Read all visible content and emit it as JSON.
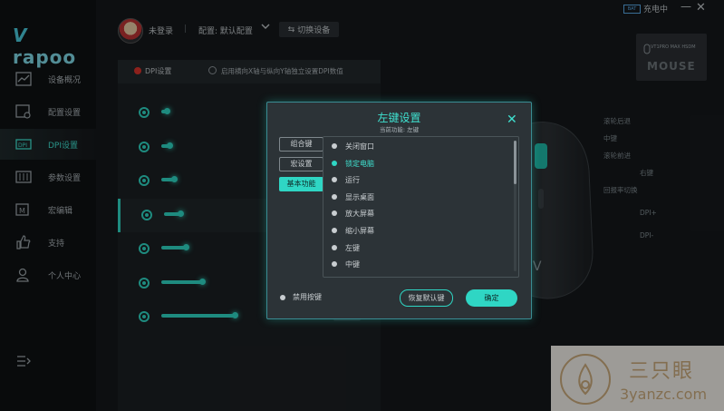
{
  "app": {
    "logo": "rapoo"
  },
  "sidebar": {
    "items": [
      {
        "label": "设备概况",
        "icon": "chart-icon"
      },
      {
        "label": "配置设置",
        "icon": "settings-card-icon"
      },
      {
        "label": "DPI设置",
        "icon": "dpi-icon"
      },
      {
        "label": "参数设置",
        "icon": "sliders-icon"
      },
      {
        "label": "宏编辑",
        "icon": "macro-icon"
      },
      {
        "label": "支持",
        "icon": "thumbs-up-icon"
      },
      {
        "label": "个人中心",
        "icon": "user-icon"
      }
    ],
    "active_index": 2
  },
  "topbar": {
    "user": "未登录",
    "separator": "|",
    "config": "配置: 默认配置",
    "switch_device": "切换设备",
    "status_icon_label": "BAT",
    "status": "充电中"
  },
  "device": {
    "model": "VT1PRO MAX HSDM",
    "tag": "MOUSE"
  },
  "dpi_panel": {
    "title": "DPI设置",
    "independent_option": "启用横向X轴与纵向Y轴独立设置DPI数值",
    "rows": [
      {
        "level": 0.03,
        "active": false
      },
      {
        "level": 0.05,
        "active": false
      },
      {
        "level": 0.08,
        "active": false
      },
      {
        "level": 0.1,
        "active": true
      },
      {
        "level": 0.15,
        "active": false
      },
      {
        "level": 0.25,
        "active": false
      },
      {
        "level": 0.45,
        "active": false
      }
    ]
  },
  "mouse_callouts": [
    "滚轮后退",
    "中键",
    "滚轮前进",
    "右键",
    "回报率切换",
    "DPI+",
    "DPI-"
  ],
  "modal": {
    "title": "左键设置",
    "subtitle": "当前功能: 左键",
    "tabs": [
      "组合键",
      "宏设置",
      "基本功能"
    ],
    "active_tab": 2,
    "functions": [
      "关闭窗口",
      "锁定电脑",
      "运行",
      "显示桌面",
      "放大屏幕",
      "缩小屏幕",
      "左键",
      "中键"
    ],
    "selected_index": 1,
    "disable_label": "禁用按键",
    "restore_label": "恢复默认键",
    "ok_label": "确定"
  },
  "watermark": {
    "cn": "三只眼",
    "en": "3yanzc.com"
  },
  "colors": {
    "accent": "#2fd6c4",
    "background": "#15181b",
    "record_dot": "#d9342b"
  }
}
